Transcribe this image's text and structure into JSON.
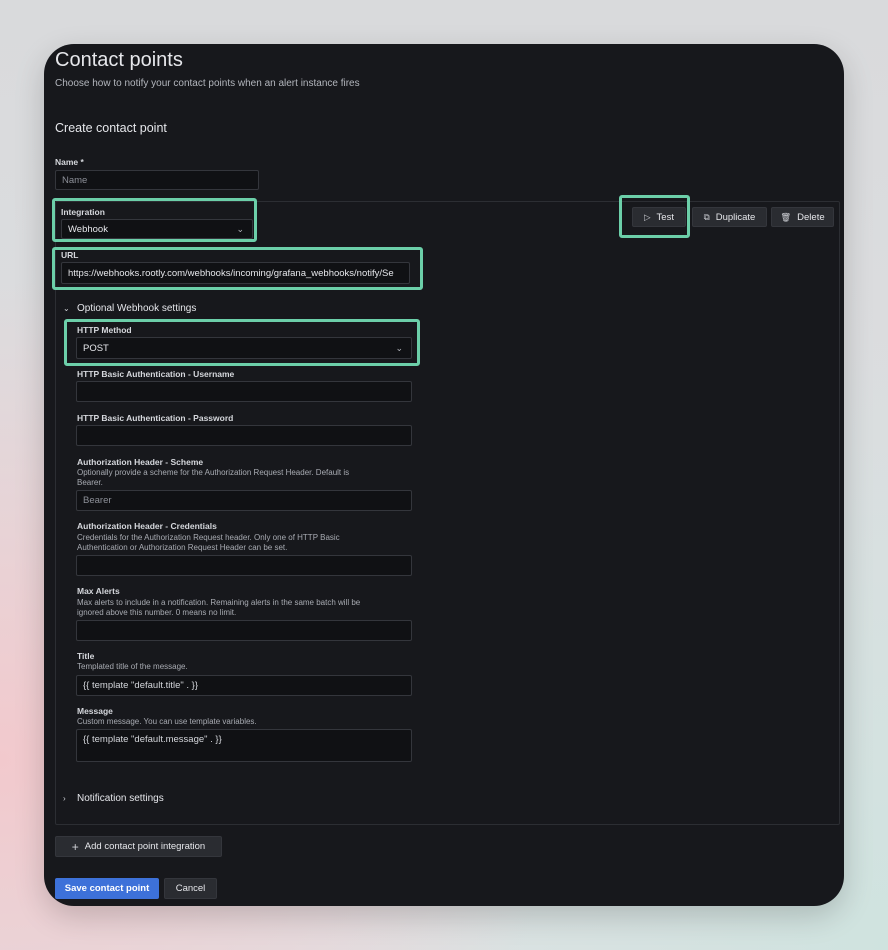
{
  "header": {
    "title": "Contact points",
    "subtitle": "Choose how to notify your contact points when an alert instance fires"
  },
  "form": {
    "section_title": "Create contact point",
    "name": {
      "label": "Name *",
      "placeholder": "Name",
      "value": ""
    },
    "integration": {
      "label": "Integration",
      "value": "Webhook"
    },
    "url": {
      "label": "URL",
      "value": "https://webhooks.rootly.com/webhooks/incoming/grafana_webhooks/notify/Se"
    },
    "actions": {
      "test": "Test",
      "duplicate": "Duplicate",
      "delete": "Delete"
    },
    "optional": {
      "toggle_label": "Optional Webhook settings",
      "http_method": {
        "label": "HTTP Method",
        "value": "POST"
      },
      "basic_user": {
        "label": "HTTP Basic Authentication - Username",
        "value": ""
      },
      "basic_pass": {
        "label": "HTTP Basic Authentication - Password",
        "value": ""
      },
      "auth_scheme": {
        "label": "Authorization Header - Scheme",
        "desc_1": "Optionally provide a scheme for the Authorization Request Header. Default is",
        "desc_2": "Bearer.",
        "placeholder": "Bearer"
      },
      "auth_creds": {
        "label": "Authorization Header - Credentials",
        "desc_1": "Credentials for the Authorization Request header. Only one of HTTP Basic",
        "desc_2": "Authentication or Authorization Request Header can be set.",
        "value": ""
      },
      "max_alerts": {
        "label": "Max Alerts",
        "desc_1": "Max alerts to include in a notification. Remaining alerts in the same batch will be",
        "desc_2": "ignored above this number. 0 means no limit.",
        "value": ""
      },
      "title": {
        "label": "Title",
        "desc": "Templated title of the message.",
        "placeholder": "{{ template \"default.title\" . }}"
      },
      "message": {
        "label": "Message",
        "desc": "Custom message. You can use template variables.",
        "placeholder": "{{ template \"default.message\" . }}"
      }
    },
    "notification_settings": "Notification settings",
    "add_integration": "Add contact point integration",
    "save": "Save contact point",
    "cancel": "Cancel"
  },
  "colors": {
    "highlight": "#6ccfa9",
    "primary": "#3d71d9",
    "panel_bg": "#17181c"
  }
}
